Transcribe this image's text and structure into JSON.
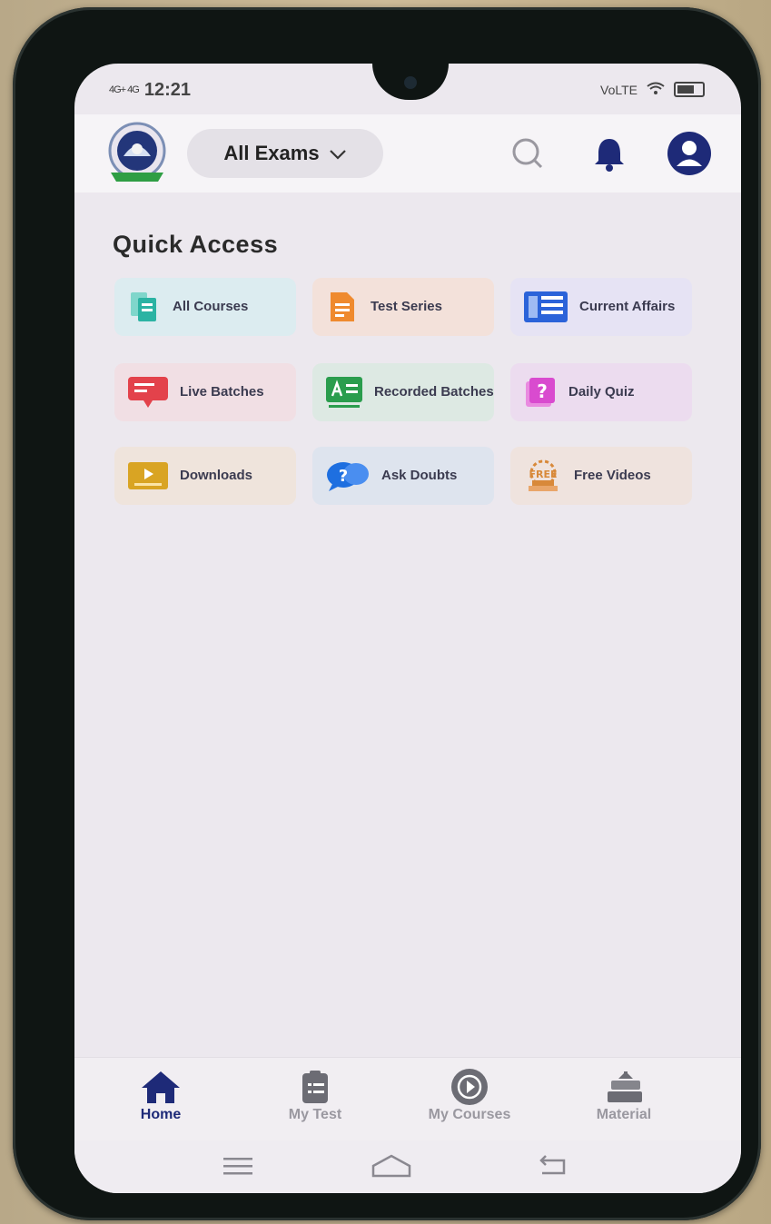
{
  "status_bar": {
    "time": "12:21",
    "left_indicators": "4G+ 4G",
    "right_indicators": "VoLTE"
  },
  "header": {
    "exam_selector": "All Exams",
    "logo_alt": "institute-logo"
  },
  "quick_access": {
    "title": "Quick Access",
    "tiles": [
      {
        "label": "All Courses",
        "icon": "courses-icon",
        "color": "#2bb3a3"
      },
      {
        "label": "Test Series",
        "icon": "document-icon",
        "color": "#ef8a2e"
      },
      {
        "label": "Current Affairs",
        "icon": "newspaper-icon",
        "color": "#2b63d9"
      },
      {
        "label": "Live Batches",
        "icon": "live-icon",
        "color": "#e3424b"
      },
      {
        "label": "Recorded Batches",
        "icon": "recorded-icon",
        "color": "#2a9d4d"
      },
      {
        "label": "Daily Quiz",
        "icon": "quiz-icon",
        "color": "#d94bcf"
      },
      {
        "label": "Downloads",
        "icon": "download-icon",
        "color": "#d9a423"
      },
      {
        "label": "Ask Doubts",
        "icon": "chat-question-icon",
        "color": "#1e6fe0"
      },
      {
        "label": "Free Videos",
        "icon": "free-video-icon",
        "color": "#d8893a"
      }
    ]
  },
  "bottom_nav": [
    {
      "label": "Home",
      "icon": "home-icon",
      "active": true
    },
    {
      "label": "My Test",
      "icon": "clipboard-icon",
      "active": false
    },
    {
      "label": "My Courses",
      "icon": "play-circle-icon",
      "active": false
    },
    {
      "label": "Material",
      "icon": "books-icon",
      "active": false
    }
  ],
  "colors": {
    "accent": "#1e2a78",
    "background": "#ece8ee"
  }
}
